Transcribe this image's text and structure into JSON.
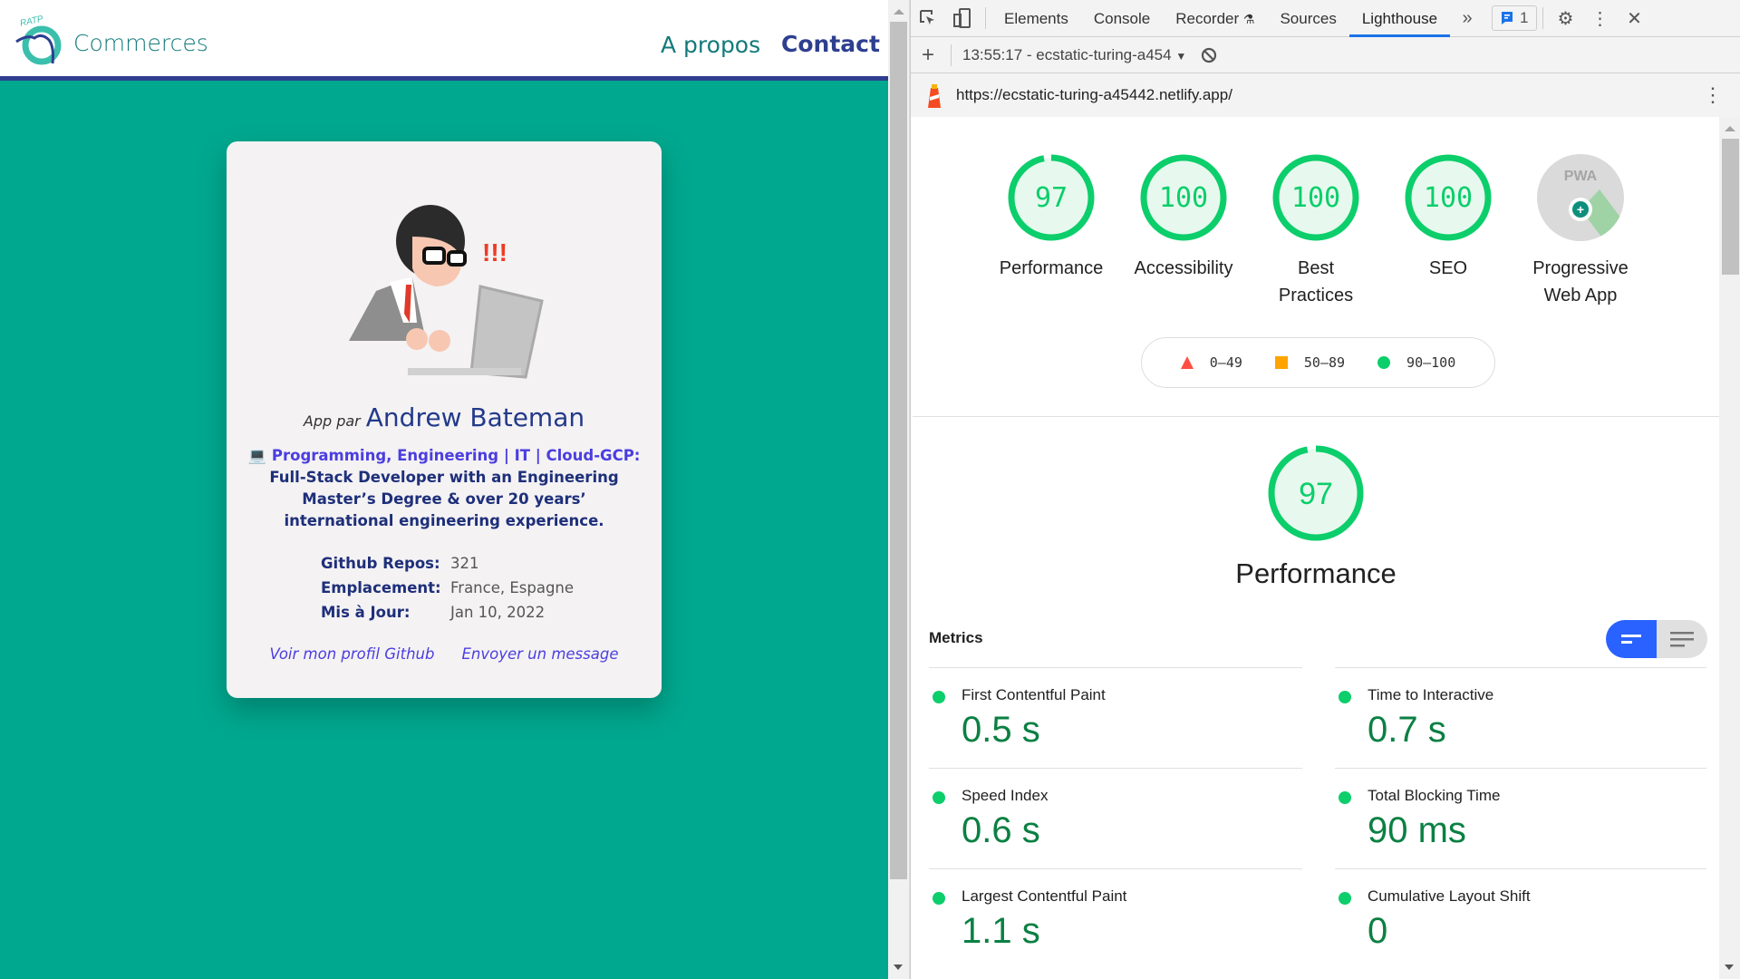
{
  "page": {
    "brand": "Commerces",
    "logo_text": "RATP",
    "nav": {
      "about": "A propos",
      "contact": "Contact"
    },
    "card": {
      "byline_prefix": "App par",
      "author": "Andrew Bateman",
      "bio_emoji": "💻",
      "bio_highlight": "Programming, Engineering | IT | Cloud-GCP:",
      "bio_text": "Full-Stack Developer with an Engineering Master’s Degree & over 20 years’ international engineering experience.",
      "facts": [
        {
          "label": "Github Repos:",
          "value": "321"
        },
        {
          "label": "Emplacement:",
          "value": "France, Espagne"
        },
        {
          "label": "Mis à Jour:",
          "value": "Jan 10, 2022"
        }
      ],
      "links": {
        "github": "Voir mon profil Github",
        "message": "Envoyer un message"
      }
    }
  },
  "devtools": {
    "tabs": [
      "Elements",
      "Console",
      "Recorder",
      "Sources",
      "Lighthouse"
    ],
    "active_tab": "Lighthouse",
    "more_tabs": "»",
    "issues_count": "1",
    "report_selector": "13:55:17 - ecstatic-turing-a454",
    "url": "https://ecstatic-turing-a45442.netlify.app/",
    "colors": {
      "pass": "#0cce6b",
      "average": "#ffa400",
      "fail": "#ff4e42",
      "value": "#0b8043"
    },
    "categories": [
      {
        "label": "Performance",
        "score": "97"
      },
      {
        "label": "Accessibility",
        "score": "100"
      },
      {
        "label": "Best Practices",
        "score": "100"
      },
      {
        "label": "SEO",
        "score": "100"
      },
      {
        "label": "Progressive Web App",
        "score": "PWA"
      }
    ],
    "legend": [
      {
        "shape": "triangle",
        "range": "0–49"
      },
      {
        "shape": "square",
        "range": "50–89"
      },
      {
        "shape": "circle",
        "range": "90–100"
      }
    ],
    "performance": {
      "score": "97",
      "title": "Performance"
    },
    "metrics_title": "Metrics",
    "metrics": [
      {
        "name": "First Contentful Paint",
        "value": "0.5 s"
      },
      {
        "name": "Time to Interactive",
        "value": "0.7 s"
      },
      {
        "name": "Speed Index",
        "value": "0.6 s"
      },
      {
        "name": "Total Blocking Time",
        "value": "90 ms"
      },
      {
        "name": "Largest Contentful Paint",
        "value": "1.1 s"
      },
      {
        "name": "Cumulative Layout Shift",
        "value": "0"
      }
    ]
  }
}
